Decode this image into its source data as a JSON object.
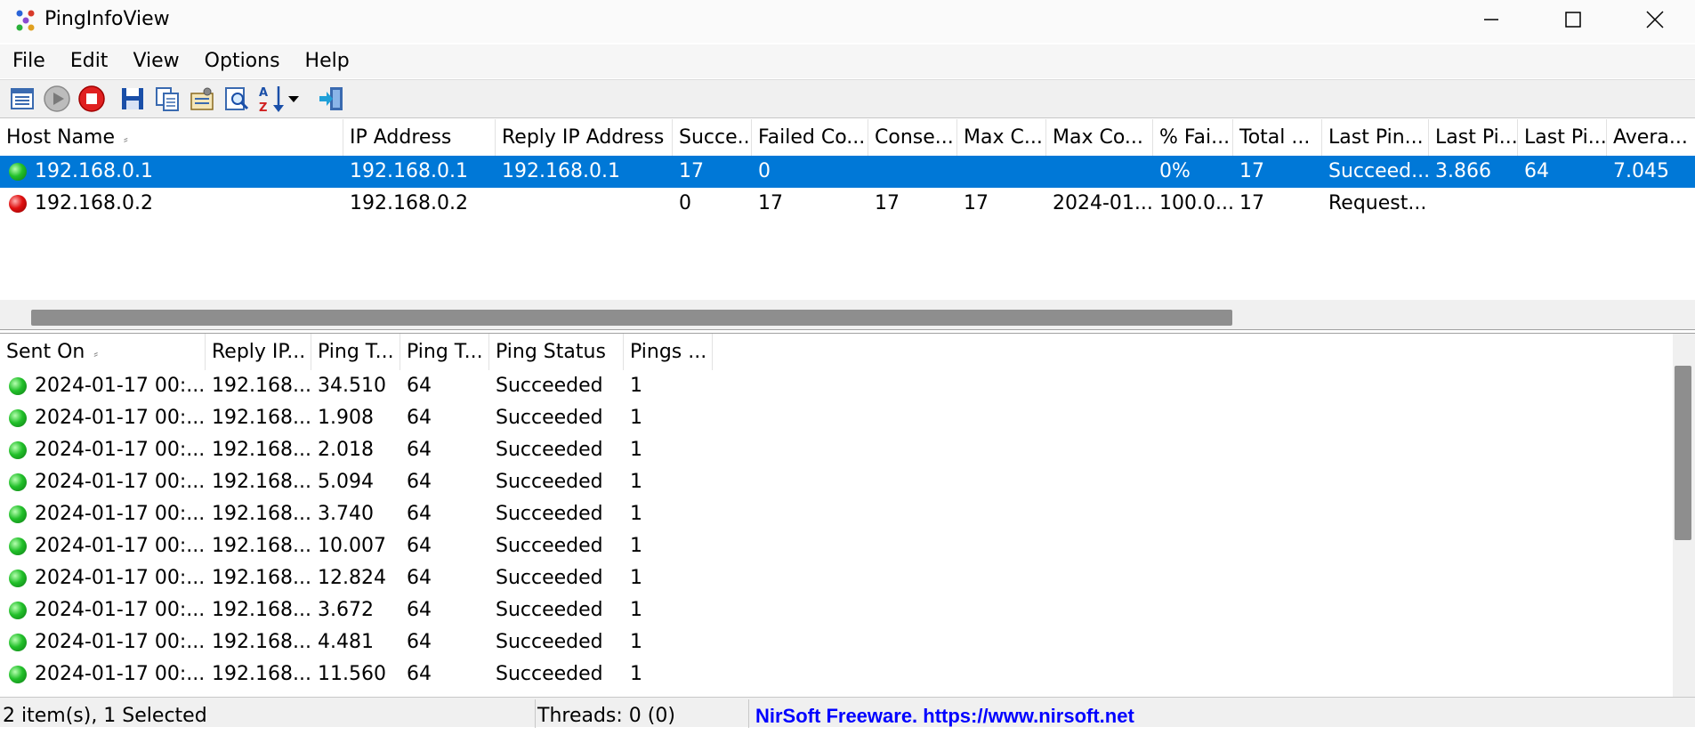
{
  "window": {
    "title": "PingInfoView"
  },
  "menu": [
    "File",
    "Edit",
    "View",
    "Options",
    "Help"
  ],
  "toolbar_icons": [
    "properties-icon",
    "start-icon",
    "stop-icon",
    "save-icon",
    "copy-icon",
    "options-icon",
    "find-icon",
    "sort-icon",
    "dropdown-arrow-icon",
    "exit-icon"
  ],
  "hosts": {
    "columns": [
      "Host Name",
      "IP Address",
      "Reply IP Address",
      "Succe...",
      "Failed Co...",
      "Conse...",
      "Max C...",
      "Max Co...",
      "% Fai...",
      "Total ...",
      "Last Pin...",
      "Last Pi...",
      "Last Pi...",
      "Avera..."
    ],
    "rows": [
      {
        "status": "green",
        "selected": true,
        "cells": [
          "192.168.0.1",
          "192.168.0.1",
          "192.168.0.1",
          "17",
          "0",
          "",
          "",
          "",
          "0%",
          "17",
          "Succeed...",
          "3.866",
          "64",
          "7.045"
        ]
      },
      {
        "status": "red",
        "selected": false,
        "cells": [
          "192.168.0.2",
          "192.168.0.2",
          "",
          "0",
          "17",
          "17",
          "17",
          "2024-01...",
          "100.0...",
          "17",
          "Request...",
          "",
          "",
          " "
        ]
      }
    ]
  },
  "history": {
    "columns": [
      "Sent On",
      "Reply IP...",
      "Ping T...",
      "Ping T...",
      "Ping Status",
      "Pings ..."
    ],
    "rows": [
      [
        "2024-01-17 00:...",
        "192.168....",
        "34.510",
        "64",
        "Succeeded",
        "1"
      ],
      [
        "2024-01-17 00:...",
        "192.168....",
        "1.908",
        "64",
        "Succeeded",
        "1"
      ],
      [
        "2024-01-17 00:...",
        "192.168....",
        "2.018",
        "64",
        "Succeeded",
        "1"
      ],
      [
        "2024-01-17 00:...",
        "192.168....",
        "5.094",
        "64",
        "Succeeded",
        "1"
      ],
      [
        "2024-01-17 00:...",
        "192.168....",
        "3.740",
        "64",
        "Succeeded",
        "1"
      ],
      [
        "2024-01-17 00:...",
        "192.168....",
        "10.007",
        "64",
        "Succeeded",
        "1"
      ],
      [
        "2024-01-17 00:...",
        "192.168....",
        "12.824",
        "64",
        "Succeeded",
        "1"
      ],
      [
        "2024-01-17 00:...",
        "192.168....",
        "3.672",
        "64",
        "Succeeded",
        "1"
      ],
      [
        "2024-01-17 00:...",
        "192.168....",
        "4.481",
        "64",
        "Succeeded",
        "1"
      ],
      [
        "2024-01-17 00:...",
        "192.168....",
        "11.560",
        "64",
        "Succeeded",
        "1"
      ]
    ]
  },
  "status": {
    "items": "2 item(s), 1 Selected",
    "threads": "Threads: 0 (0)",
    "link": "NirSoft Freeware. https://www.nirsoft.net"
  },
  "colors": {
    "selection": "#0078d7",
    "link": "#0000ff",
    "ok": "#22c02a",
    "fail": "#e01010"
  }
}
